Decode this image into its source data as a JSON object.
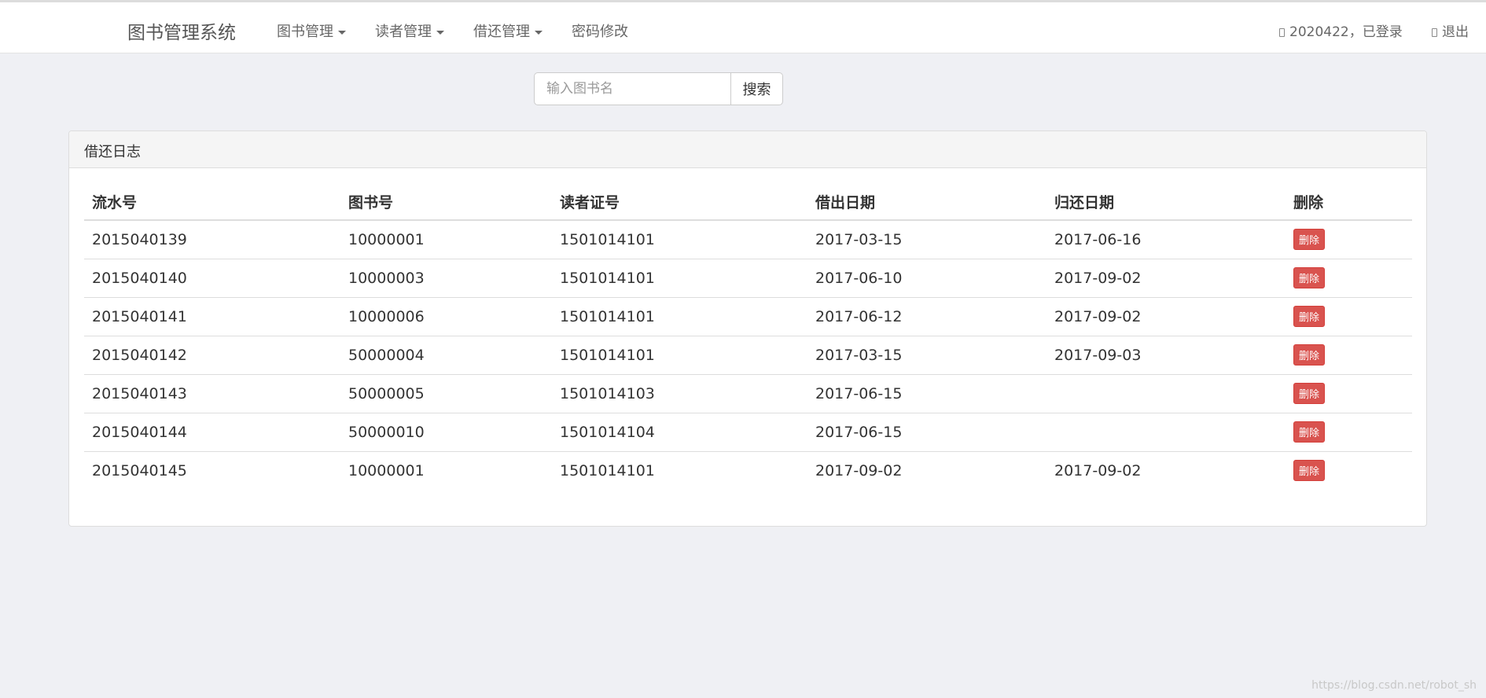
{
  "navbar": {
    "brand": "图书管理系统",
    "menus": [
      {
        "label": "图书管理"
      },
      {
        "label": "读者管理"
      },
      {
        "label": "借还管理"
      },
      {
        "label": "密码修改"
      }
    ],
    "user_status": "2020422，已登录",
    "logout_label": "退出"
  },
  "search": {
    "placeholder": "输入图书名",
    "value": "",
    "button_label": "搜索"
  },
  "panel": {
    "title": "借还日志",
    "columns": [
      "流水号",
      "图书号",
      "读者证号",
      "借出日期",
      "归还日期",
      "删除"
    ],
    "rows": [
      {
        "serial": "2015040139",
        "book_id": "10000001",
        "reader_id": "1501014101",
        "lend_date": "2017-03-15",
        "return_date": "2017-06-16",
        "action": "删除"
      },
      {
        "serial": "2015040140",
        "book_id": "10000003",
        "reader_id": "1501014101",
        "lend_date": "2017-06-10",
        "return_date": "2017-09-02",
        "action": "删除"
      },
      {
        "serial": "2015040141",
        "book_id": "10000006",
        "reader_id": "1501014101",
        "lend_date": "2017-06-12",
        "return_date": "2017-09-02",
        "action": "删除"
      },
      {
        "serial": "2015040142",
        "book_id": "50000004",
        "reader_id": "1501014101",
        "lend_date": "2017-03-15",
        "return_date": "2017-09-03",
        "action": "删除"
      },
      {
        "serial": "2015040143",
        "book_id": "50000005",
        "reader_id": "1501014103",
        "lend_date": "2017-06-15",
        "return_date": "",
        "action": "删除"
      },
      {
        "serial": "2015040144",
        "book_id": "50000010",
        "reader_id": "1501014104",
        "lend_date": "2017-06-15",
        "return_date": "",
        "action": "删除"
      },
      {
        "serial": "2015040145",
        "book_id": "10000001",
        "reader_id": "1501014101",
        "lend_date": "2017-09-02",
        "return_date": "2017-09-02",
        "action": "删除"
      }
    ]
  },
  "watermark": "https://blog.csdn.net/robot_sh",
  "colors": {
    "background": "#eff0f4",
    "danger": "#d9534f",
    "navbar": "#ffffff"
  },
  "icons": {
    "user": "user-icon",
    "logout": "logout-icon",
    "caret": "caret-down-icon"
  }
}
